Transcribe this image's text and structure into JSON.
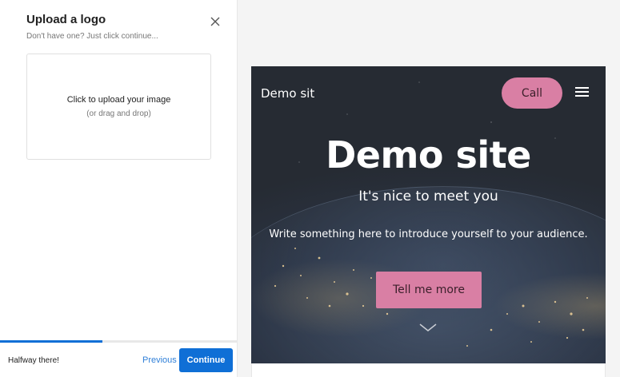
{
  "panel": {
    "title": "Upload a logo",
    "subtitle": "Don't have one? Just click continue...",
    "close_icon": "close-icon",
    "upload": {
      "main_text": "Click to upload your image",
      "sub_text": "(or drag and drop)"
    },
    "progress_percent": 43,
    "status_text": "Halfway there!",
    "previous_label": "Previous",
    "continue_label": "Continue",
    "accent_color": "#0f6fd6"
  },
  "preview": {
    "site_name": "Demo sit",
    "call_label": "Call",
    "menu_icon": "hamburger-menu-icon",
    "hero_title": "Demo site",
    "hero_subtitle": "It's nice to meet you",
    "intro_text": "Write something here to introduce yourself to your audience.",
    "cta_label": "Tell me more",
    "scroll_icon": "chevron-down-icon",
    "button_color": "#d97fa4"
  }
}
